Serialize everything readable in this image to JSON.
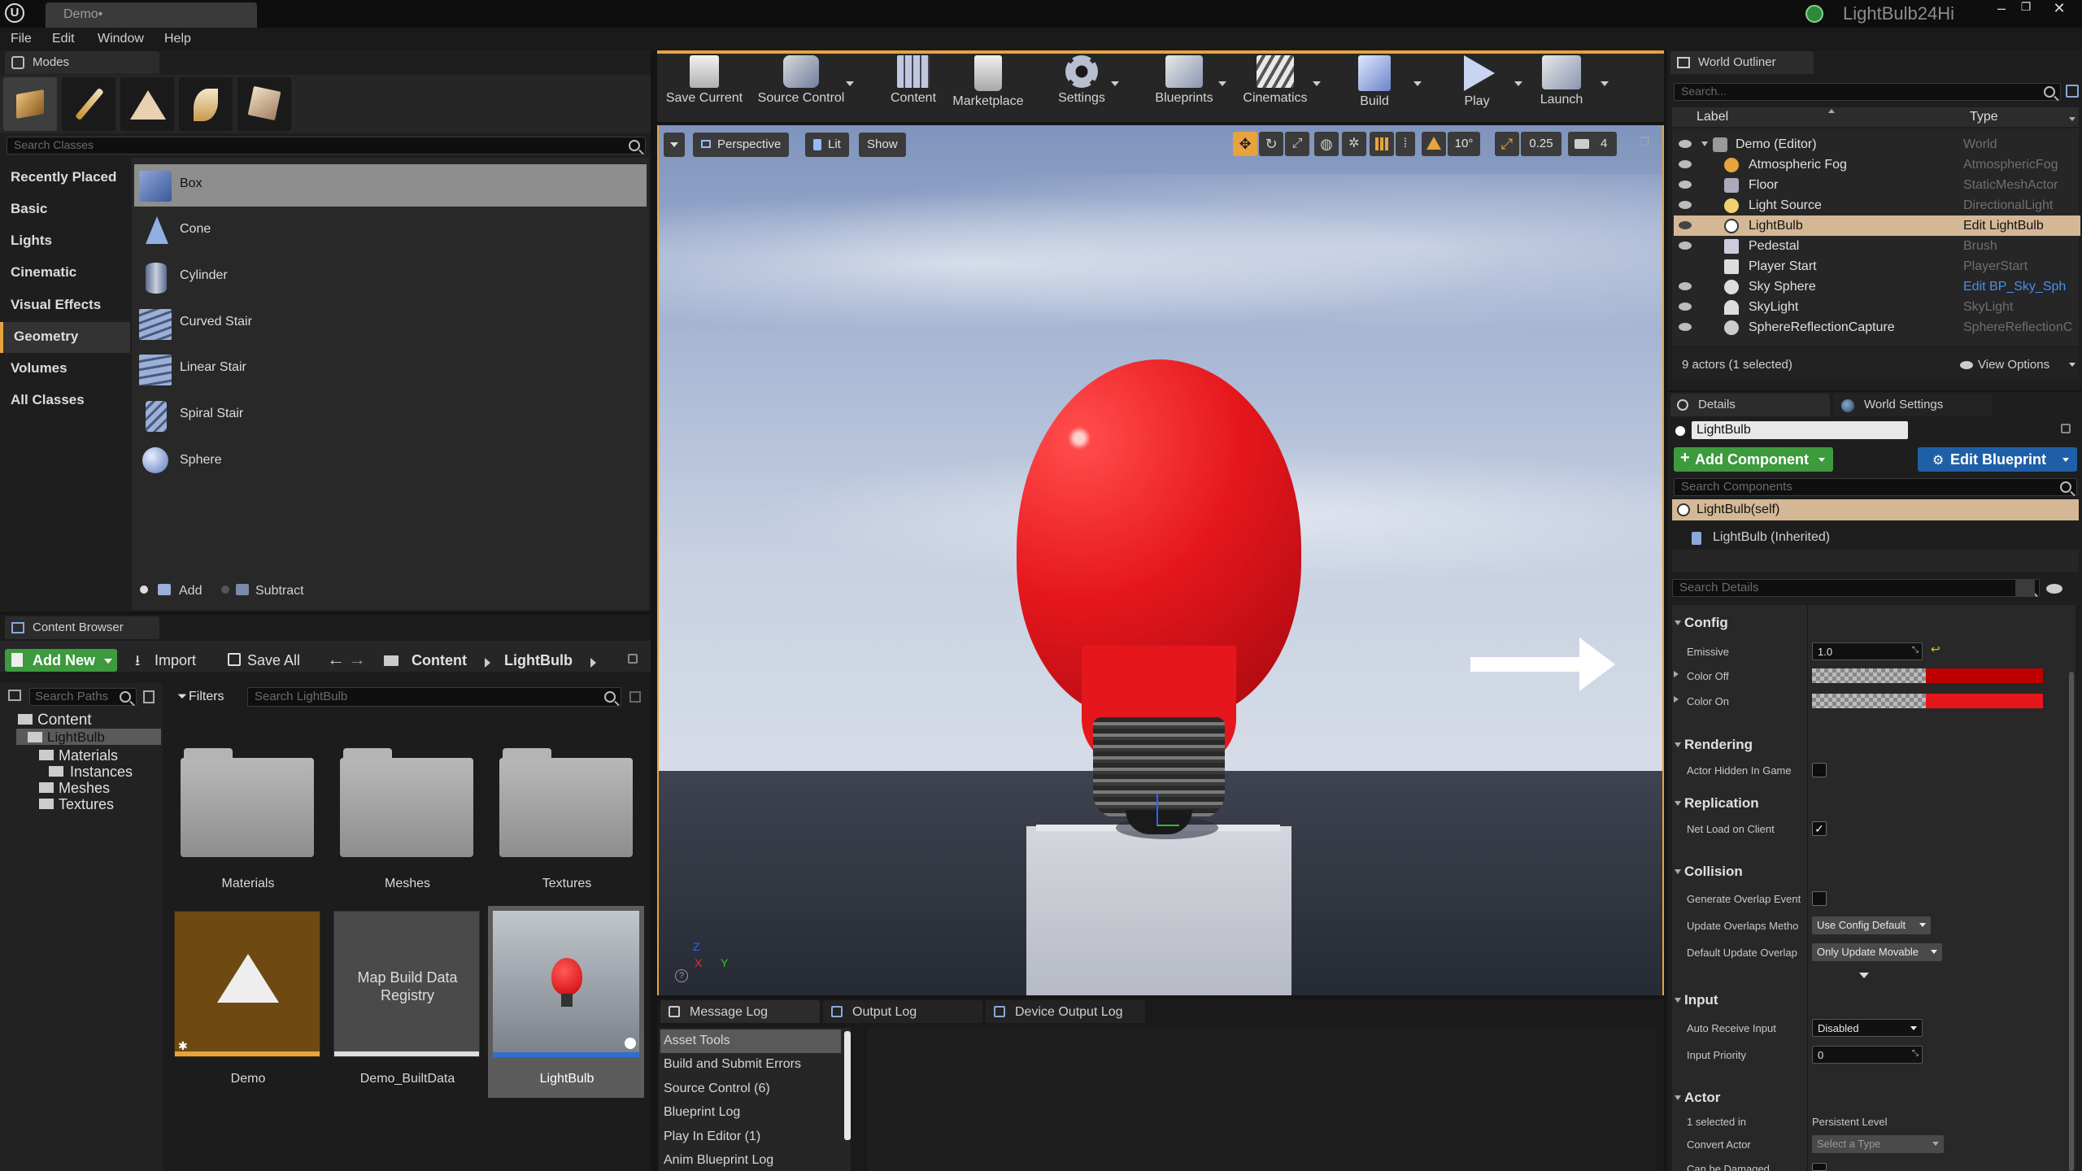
{
  "app": {
    "tab_title": "Demo•",
    "project_name": "LightBulb24Hi",
    "menu": [
      "File",
      "Edit",
      "Window",
      "Help"
    ]
  },
  "modes": {
    "tab_label": "Modes",
    "search_placeholder": "Search Classes",
    "categories": [
      "Recently Placed",
      "Basic",
      "Lights",
      "Cinematic",
      "Visual Effects",
      "Geometry",
      "Volumes",
      "All Classes"
    ],
    "selected_category": "Geometry",
    "items": [
      "Box",
      "Cone",
      "Cylinder",
      "Curved Stair",
      "Linear Stair",
      "Spiral Stair",
      "Sphere"
    ],
    "selected_item": "Box",
    "add_label": "Add",
    "subtract_label": "Subtract"
  },
  "toolbar": {
    "buttons": [
      "Save Current",
      "Source Control",
      "Content",
      "Marketplace",
      "Settings",
      "Blueprints",
      "Cinematics",
      "Build",
      "Play",
      "Launch"
    ]
  },
  "viewport": {
    "perspective_label": "Perspective",
    "lit_label": "Lit",
    "show_label": "Show",
    "snap_angle": "10°",
    "scale_snap": "0.25",
    "camera_speed": "4",
    "axis_z": "Z",
    "axis_x": "X",
    "axis_y": "Y"
  },
  "content_browser": {
    "tab_label": "Content Browser",
    "add_new": "Add New",
    "import": "Import",
    "save_all": "Save All",
    "path": [
      "Content",
      "LightBulb"
    ],
    "search_paths_placeholder": "Search Paths",
    "filters_label": "Filters",
    "search_placeholder": "Search LightBulb",
    "tree": [
      "Content",
      "LightBulb",
      "Materials",
      "Instances",
      "Meshes",
      "Textures"
    ],
    "folders": [
      "Materials",
      "Meshes",
      "Textures"
    ],
    "assets": [
      "Demo",
      "Demo_BuiltData",
      "LightBulb"
    ],
    "map_build_text": "Map Build Data Registry"
  },
  "log": {
    "tabs": [
      "Message Log",
      "Output Log",
      "Device Output Log"
    ],
    "categories": [
      "Asset Tools",
      "Build and Submit Errors",
      "Source Control (6)",
      "Blueprint Log",
      "Play In Editor (1)",
      "Anim Blueprint Log"
    ],
    "selected": "Asset Tools"
  },
  "outliner": {
    "tab_label": "World Outliner",
    "search_placeholder": "Search...",
    "col_label": "Label",
    "col_type": "Type",
    "rows": [
      {
        "label": "Demo (Editor)",
        "type": "World"
      },
      {
        "label": "Atmospheric Fog",
        "type": "AtmosphericFog"
      },
      {
        "label": "Floor",
        "type": "StaticMeshActor"
      },
      {
        "label": "Light Source",
        "type": "DirectionalLight"
      },
      {
        "label": "LightBulb",
        "type": "Edit LightBulb"
      },
      {
        "label": "Pedestal",
        "type": "Brush"
      },
      {
        "label": "Player Start",
        "type": "PlayerStart"
      },
      {
        "label": "Sky Sphere",
        "type": "Edit BP_Sky_Sph"
      },
      {
        "label": "SkyLight",
        "type": "SkyLight"
      },
      {
        "label": "SphereReflectionCapture",
        "type": "SphereReflectionC"
      }
    ],
    "summary": "9 actors (1 selected)",
    "view_options": "View Options"
  },
  "details": {
    "tab_label": "Details",
    "world_settings_tab": "World Settings",
    "name_value": "LightBulb",
    "add_component": "Add Component",
    "edit_blueprint": "Edit Blueprint",
    "search_components_placeholder": "Search Components",
    "self_component": "LightBulb(self)",
    "inherited_component": "LightBulb (Inherited)",
    "search_details_placeholder": "Search Details",
    "sections": {
      "config": "Config",
      "rendering": "Rendering",
      "replication": "Replication",
      "collision": "Collision",
      "input": "Input",
      "actor": "Actor"
    },
    "props": {
      "emissive": "Emissive",
      "emissive_value": "1.0",
      "color_off": "Color Off",
      "color_on": "Color On",
      "actor_hidden": "Actor Hidden In Game",
      "net_load": "Net Load on Client",
      "gen_overlap": "Generate Overlap Event",
      "update_overlaps": "Update Overlaps Metho",
      "update_overlaps_value": "Use Config Default",
      "default_update": "Default Update Overlap",
      "default_update_value": "Only Update Movable",
      "auto_receive": "Auto Receive Input",
      "auto_receive_value": "Disabled",
      "input_priority": "Input Priority",
      "input_priority_value": "0",
      "selected_in": "1 selected in",
      "selected_in_value": "Persistent Level",
      "convert_actor": "Convert Actor",
      "convert_actor_value": "Select a Type",
      "can_be_damaged": "Can be Damaged"
    }
  },
  "colors": {
    "accent_orange": "#e8a33d",
    "selection_row": "#d4b896",
    "add_green": "#3d9a3d",
    "edit_blue": "#1f5fa8",
    "bulb_red": "#e5171d"
  }
}
